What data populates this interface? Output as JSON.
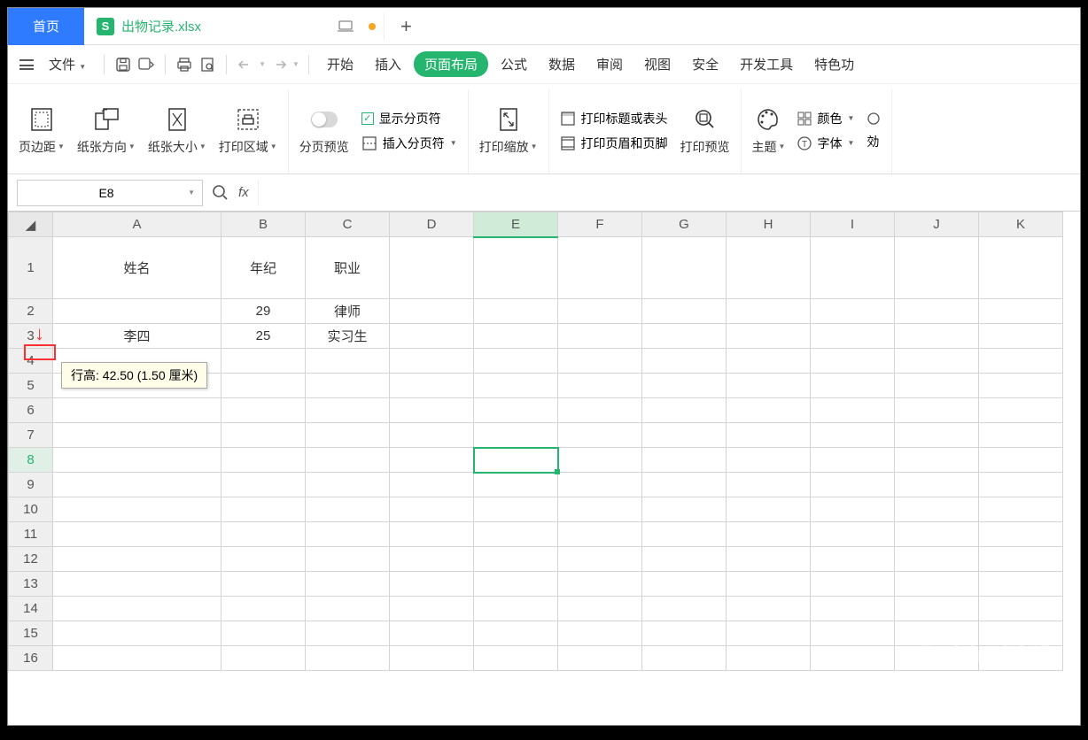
{
  "titlebar": {
    "home_tab": "首页",
    "doc_icon_letter": "S",
    "doc_name": "出物记录.xlsx",
    "plus": "+"
  },
  "menubar": {
    "file": "文件",
    "items": [
      "开始",
      "插入",
      "页面布局",
      "公式",
      "数据",
      "审阅",
      "视图",
      "安全",
      "开发工具",
      "特色功"
    ]
  },
  "ribbon": {
    "margins": "页边距",
    "orientation": "纸张方向",
    "size": "纸张大小",
    "print_area": "打印区域",
    "page_break_preview": "分页预览",
    "show_page_breaks": "显示分页符",
    "insert_page_break": "插入分页符",
    "print_scale": "打印缩放",
    "print_titles": "打印标题或表头",
    "print_header_footer": "打印页眉和页脚",
    "print_preview": "打印预览",
    "theme": "主题",
    "colors": "颜色",
    "fonts": "字体",
    "effects": "効"
  },
  "formula_bar": {
    "name_box": "E8",
    "fx": "fx"
  },
  "columns": [
    "A",
    "B",
    "C",
    "D",
    "E",
    "F",
    "G",
    "H",
    "I",
    "J",
    "K"
  ],
  "rows": [
    "1",
    "2",
    "3",
    "4",
    "5",
    "6",
    "7",
    "8",
    "9",
    "10",
    "11",
    "12",
    "13",
    "14",
    "15",
    "16"
  ],
  "cells": {
    "A1": "姓名",
    "B1": "年纪",
    "C1": "职业",
    "A2": "",
    "B2": "29",
    "C2": "律师",
    "A3": "李四",
    "B3": "25",
    "C3": "实习生"
  },
  "tooltip": "行高: 42.50 (1.50 厘米)",
  "watermark": {
    "brand": "Baidu 经验",
    "url": "jingyan.baidu.com"
  },
  "active_cell": "E8"
}
